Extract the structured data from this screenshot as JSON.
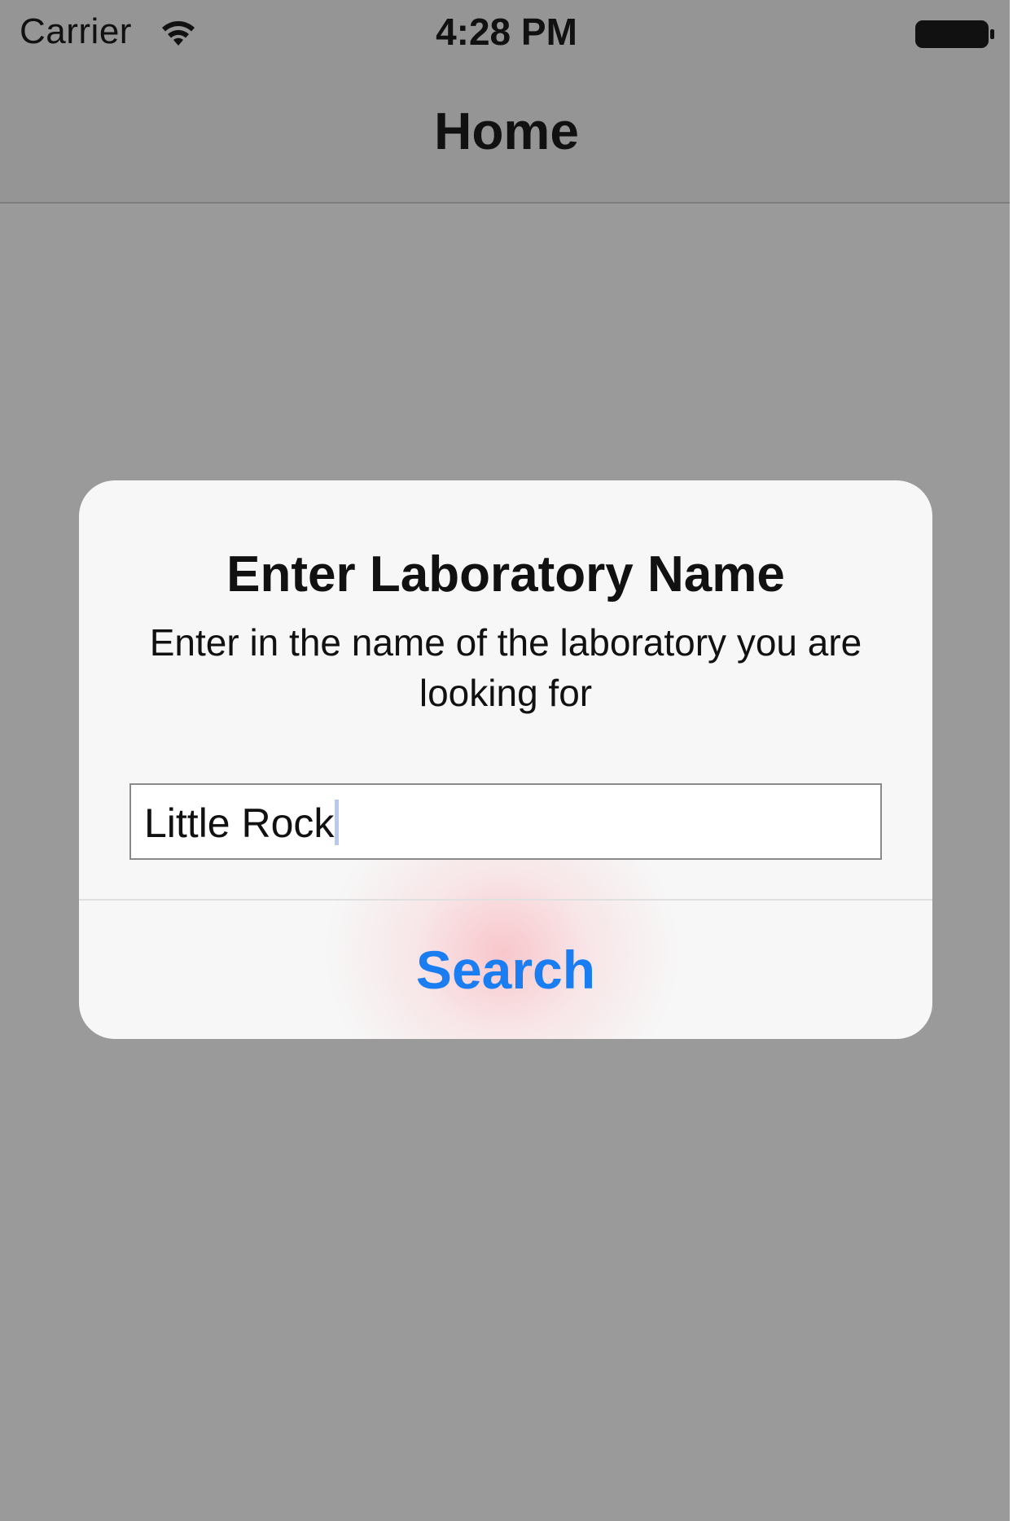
{
  "status_bar": {
    "carrier": "Carrier",
    "time": "4:28 PM",
    "icons": [
      "wifi-icon",
      "battery-icon"
    ]
  },
  "nav_bar": {
    "title": "Home"
  },
  "alert": {
    "title": "Enter Laboratory Name",
    "message": "Enter in the name of the laboratory you are looking for",
    "input_value": "Little Rock",
    "button_label": "Search"
  },
  "colors": {
    "dimmed_background": "#9a9a9a",
    "alert_background": "#f7f7f7",
    "button_text": "#1a7df2"
  }
}
